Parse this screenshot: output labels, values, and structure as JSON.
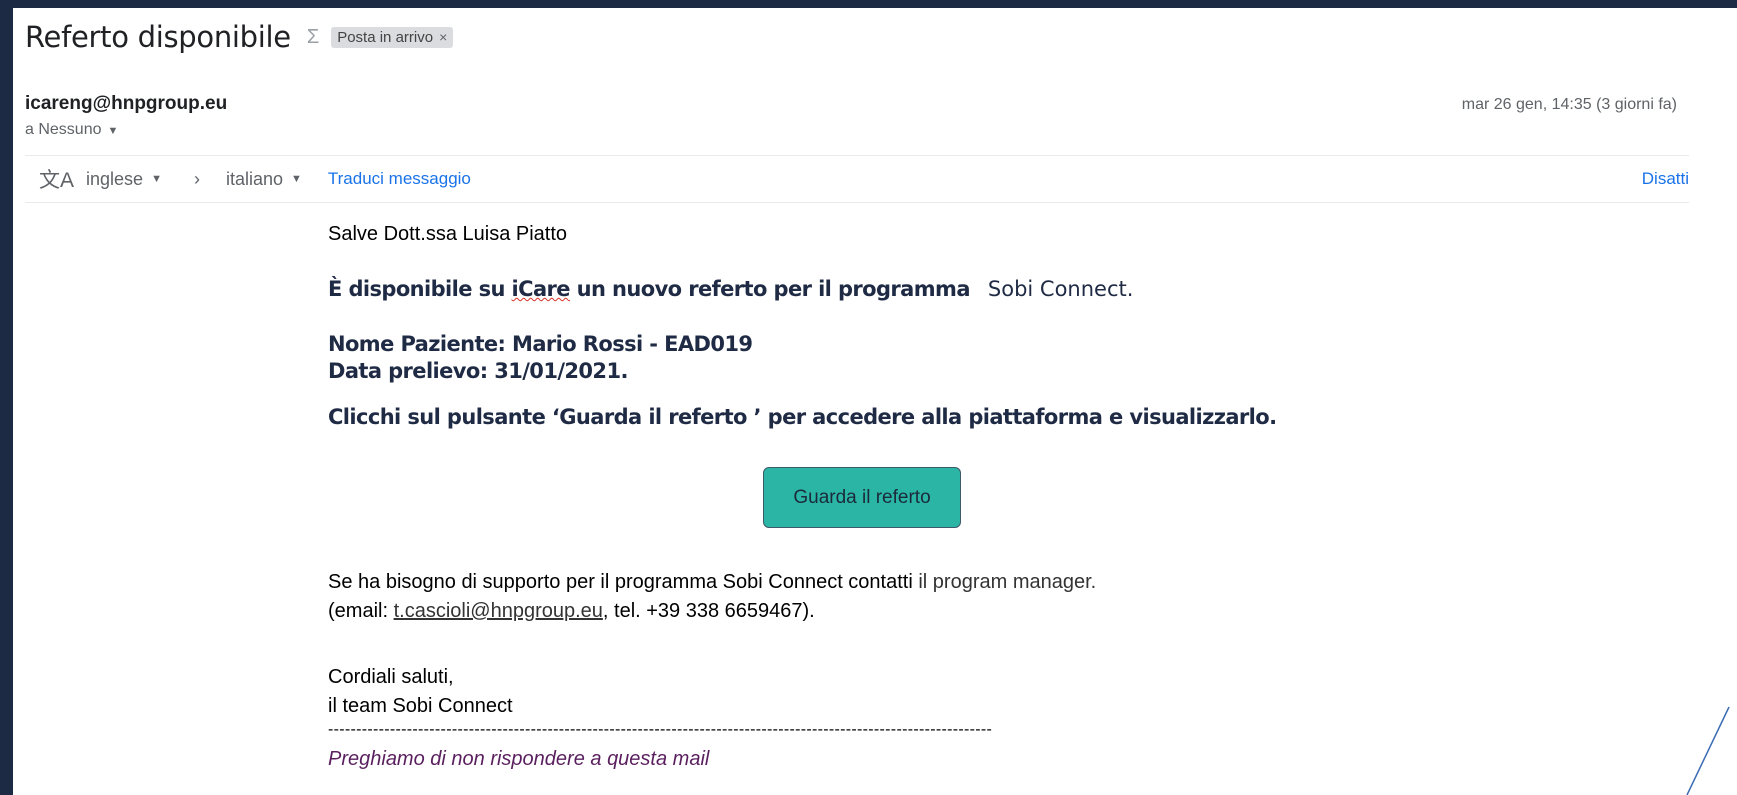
{
  "header": {
    "subject": "Referto disponibile",
    "label_chip": "Posta in arrivo",
    "label_chip_close": "×"
  },
  "sender": {
    "email": "icareng@hnpgroup.eu",
    "recipient": "a Nessuno",
    "date": "mar 26 gen, 14:35 (3 giorni fa)"
  },
  "translate": {
    "source_lang": "inglese",
    "target_lang": "italiano",
    "translate_link": "Traduci messaggio",
    "disable_link": "Disatti"
  },
  "message": {
    "greeting": "Salve Dott.ssa Luisa Piatto",
    "available_prefix": "È disponibile su ",
    "available_app": "iCare",
    "available_suffix": " un nuovo referto per il programma",
    "program_name": "Sobi Connect.",
    "patient_line": "Nome Paziente: Mario Rossi - EAD019",
    "date_line": "Data prelievo: 31/01/2021.",
    "click_instruction": "Clicchi sul pulsante ‘Guarda il referto ’ per accedere alla piattaforma e visualizzarlo.",
    "button_label": "Guarda il referto",
    "support_text": "Se ha bisogno di supporto per il programma Sobi Connect contatti",
    "support_manager": " il program manager.",
    "contact_prefix": "(email: ",
    "contact_email": "t.cascioli@hnpgroup.eu",
    "contact_suffix": ", tel. +39 338 6659467).",
    "closing": "Cordiali saluti,",
    "signature": "il team Sobi Connect",
    "separator": "----------------------------------------------------------------------------------------------------------------------",
    "no_reply": "Preghiamo di non rispondere a questa mail"
  },
  "colors": {
    "button_bg": "#2bb5a5",
    "link": "#1a73e8",
    "background_frame": "#1c2a44"
  }
}
